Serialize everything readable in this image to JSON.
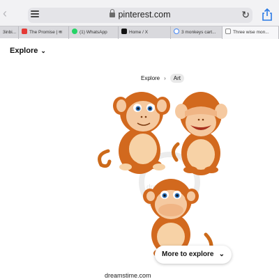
{
  "browser": {
    "url": "pinterest.com",
    "tabs": [
      {
        "label": "3inbi..."
      },
      {
        "label": "The Promise | क"
      },
      {
        "label": "(1) WhatsApp"
      },
      {
        "label": "Home / X"
      },
      {
        "label": "3 monkeys cart..."
      },
      {
        "label": "Three wise mon..."
      }
    ]
  },
  "page": {
    "explore_label": "Explore",
    "breadcrumb": {
      "first": "Explore",
      "second": "Art"
    },
    "more_button": "More to explore",
    "source": "dreamstime.com",
    "watermark_text": "dreamstime"
  },
  "colors": {
    "monkey_brown": "#d2691e",
    "monkey_face": "#f5c9a0",
    "tab_active": "#f7f7f9"
  }
}
